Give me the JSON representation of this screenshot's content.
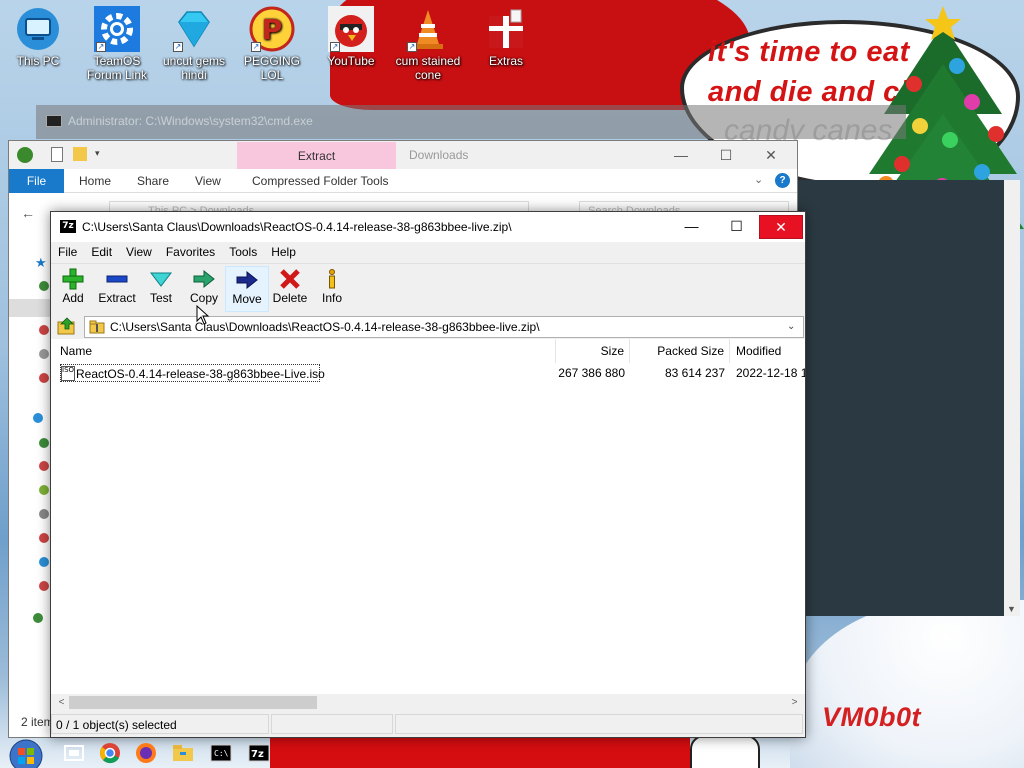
{
  "desktop": {
    "icons": [
      {
        "label": "This PC",
        "icon": "computer-icon"
      },
      {
        "label": "TeamOS Forum Link",
        "icon": "gear-icon"
      },
      {
        "label": "uncut gems hindi",
        "icon": "diamond-icon"
      },
      {
        "label": "PEGGING LOL",
        "icon": "letter-p-icon"
      },
      {
        "label": "YouTube",
        "icon": "angry-bird-icon"
      },
      {
        "label": "cum stained cone",
        "icon": "traffic-cone-icon"
      },
      {
        "label": "Extras",
        "icon": "gift-box-icon"
      }
    ],
    "speech_bubble": {
      "line1": "it's time to eat",
      "line2": "and die and cl",
      "faded": "candy canes"
    },
    "watermark": "VM0b0t"
  },
  "cmd_window": {
    "title": "Administrator: C:\\Windows\\system32\\cmd.exe"
  },
  "explorer": {
    "context_tab": "Extract",
    "title": "Downloads",
    "ribbon_tabs": [
      "File",
      "Home",
      "Share",
      "View",
      "Compressed Folder Tools"
    ],
    "address": "This PC > Downloads",
    "search_placeholder": "Search Downloads",
    "status": "2 items"
  },
  "sevenzip": {
    "icon_text": "7z",
    "title": "C:\\Users\\Santa Claus\\Downloads\\ReactOS-0.4.14-release-38-g863bbee-live.zip\\",
    "menu": [
      "File",
      "Edit",
      "View",
      "Favorites",
      "Tools",
      "Help"
    ],
    "toolbar": [
      {
        "label": "Add",
        "icon": "plus-icon"
      },
      {
        "label": "Extract",
        "icon": "minus-icon"
      },
      {
        "label": "Test",
        "icon": "check-icon"
      },
      {
        "label": "Copy",
        "icon": "copy-arrow-icon"
      },
      {
        "label": "Move",
        "icon": "move-arrow-icon"
      },
      {
        "label": "Delete",
        "icon": "delete-x-icon"
      },
      {
        "label": "Info",
        "icon": "info-icon"
      }
    ],
    "address": "C:\\Users\\Santa Claus\\Downloads\\ReactOS-0.4.14-release-38-g863bbee-live.zip\\",
    "columns": {
      "name": "Name",
      "size": "Size",
      "packed": "Packed Size",
      "modified": "Modified"
    },
    "files": [
      {
        "name": "ReactOS-0.4.14-release-38-g863bbee-Live.iso",
        "size": "267 386 880",
        "packed": "83 614 237",
        "modified": "2022-12-18 1"
      }
    ],
    "status_left": "0 / 1 object(s) selected",
    "status_mid": "",
    "status_right": ""
  },
  "colors": {
    "close_red": "#e81123",
    "explorer_file_tab": "#1979ca",
    "context_tab": "#f8c7de",
    "bubble_text": "#d41414"
  }
}
